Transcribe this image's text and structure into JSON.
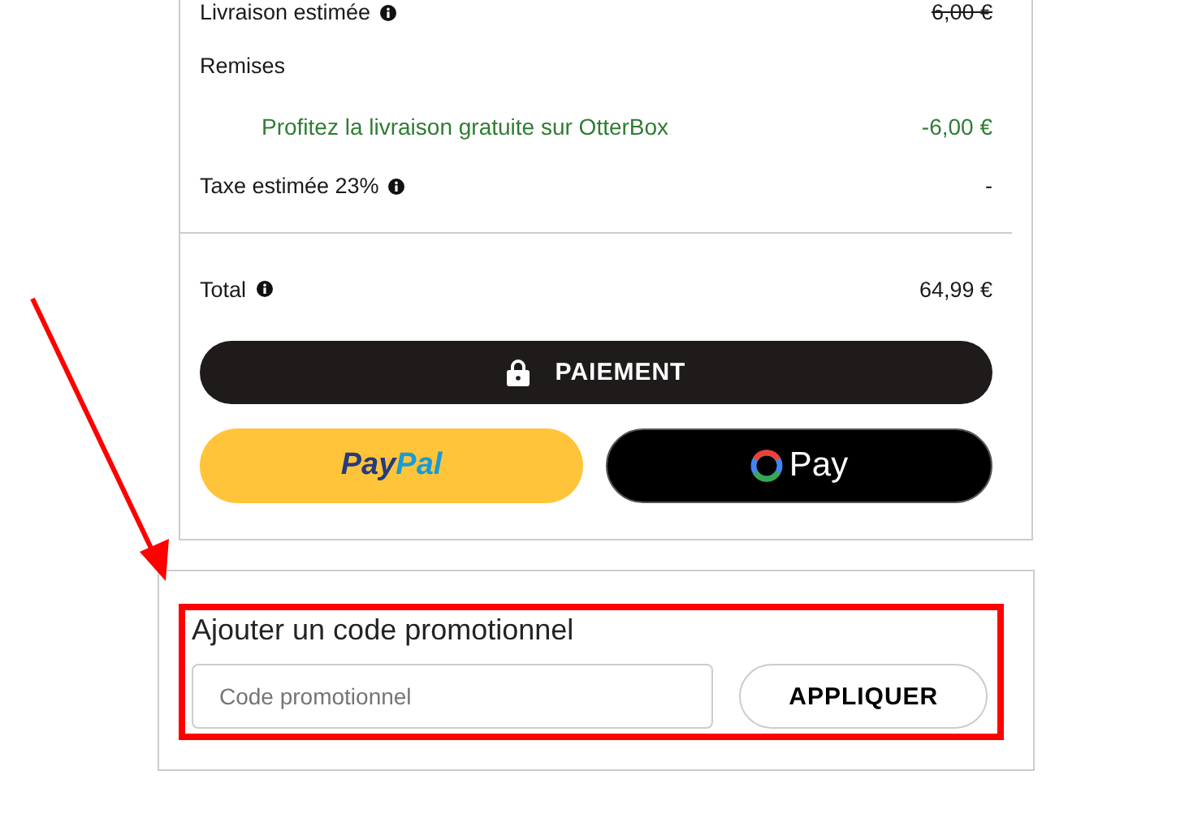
{
  "summary": {
    "rows": [
      {
        "kind": "line",
        "label": "Livraison estimée",
        "info": true,
        "value": "6,00 €",
        "struck": true
      },
      {
        "kind": "heading",
        "label": "Remises"
      },
      {
        "kind": "discount",
        "label": "Profitez la livraison gratuite sur OtterBox",
        "value": "-6,00 €"
      },
      {
        "kind": "line",
        "label": "Taxe estimée 23%",
        "info": true,
        "value": "-",
        "struck": false
      }
    ],
    "total": {
      "label": "Total",
      "info": true,
      "value": "64,99 €"
    },
    "checkout_button": "PAIEMENT",
    "paypal_logo": [
      "Pay",
      "Pal"
    ],
    "google_pay_label": "Pay"
  },
  "promo": {
    "title": "Ajouter un code promotionnel",
    "placeholder": "Code promotionnel",
    "apply_button": "APPLIQUER"
  }
}
